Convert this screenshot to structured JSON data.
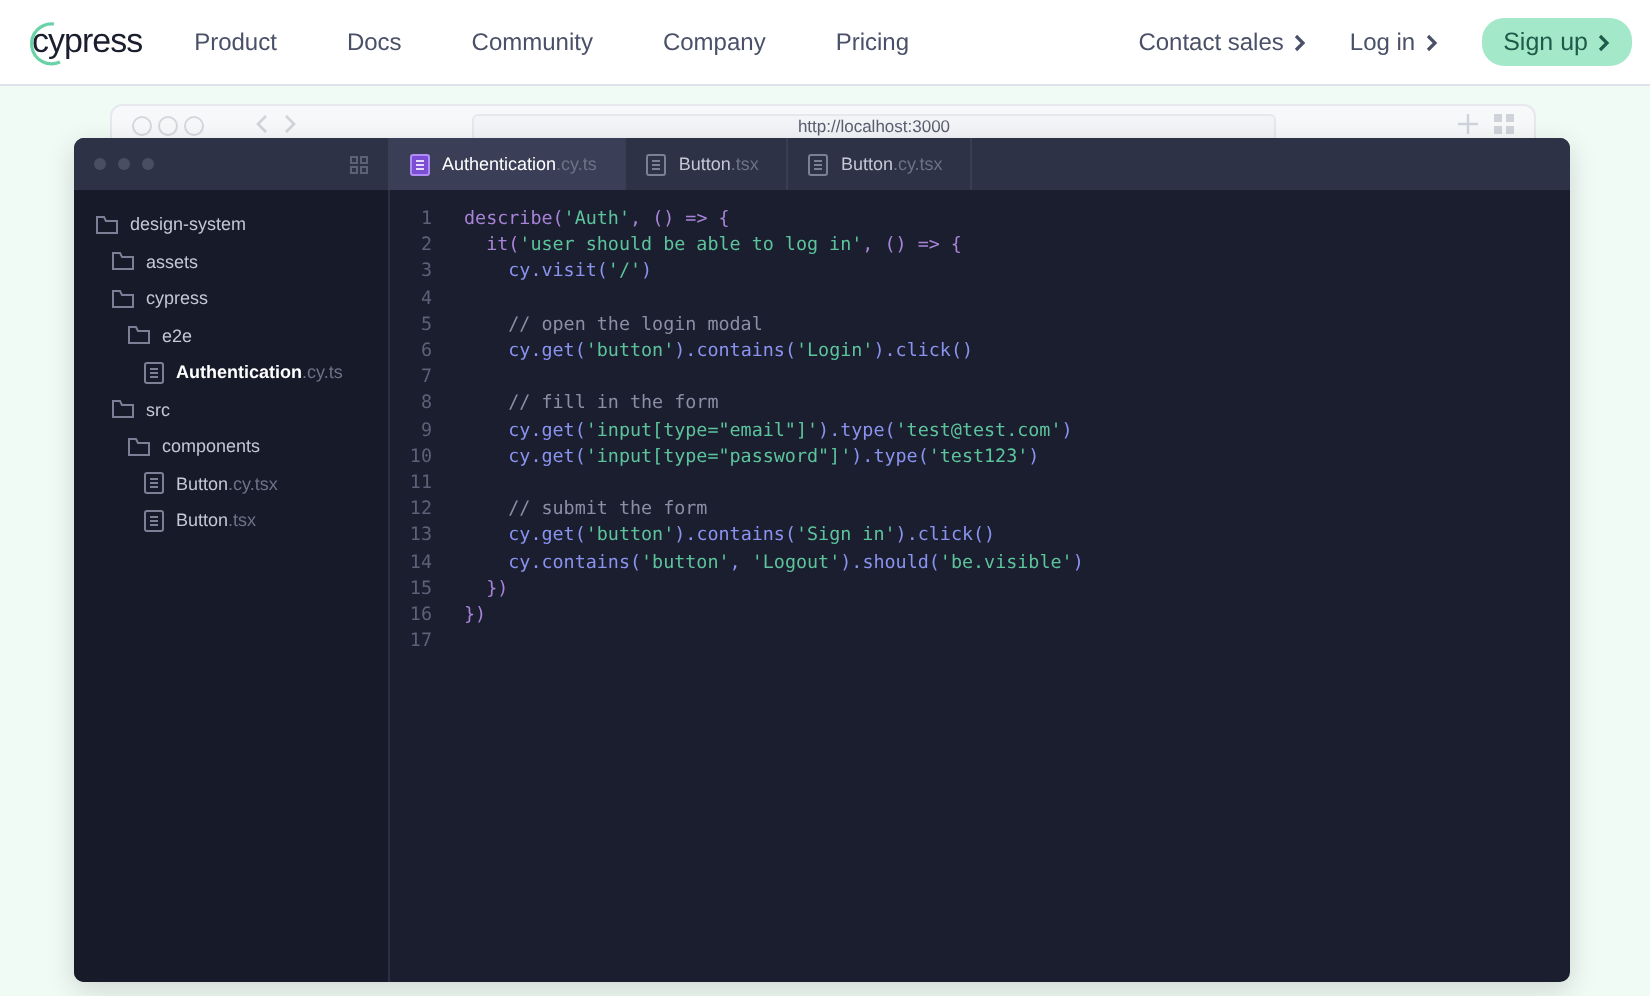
{
  "nav": {
    "logo": "cypress",
    "links": [
      "Product",
      "Docs",
      "Community",
      "Company",
      "Pricing"
    ],
    "right_links": [
      "Contact sales",
      "Log in"
    ],
    "cta": "Sign up"
  },
  "browser": {
    "url": "http://localhost:3000"
  },
  "editor": {
    "tabs": [
      {
        "name": "Authentication",
        "ext": ".cy.ts",
        "selected": true
      },
      {
        "name": "Button",
        "ext": ".tsx",
        "selected": false
      },
      {
        "name": "Button",
        "ext": ".cy.tsx",
        "selected": false
      }
    ],
    "tree": [
      {
        "kind": "folder",
        "name": "design-system",
        "selected": false,
        "children": [
          {
            "kind": "folder",
            "name": "assets",
            "selected": false
          },
          {
            "kind": "folder",
            "name": "cypress",
            "selected": false,
            "children": [
              {
                "kind": "folder",
                "name": "e2e",
                "selected": false,
                "children": [
                  {
                    "kind": "file",
                    "name": "Authentication",
                    "ext": ".cy.ts",
                    "selected": true
                  }
                ]
              }
            ]
          },
          {
            "kind": "folder",
            "name": "src",
            "selected": false,
            "children": [
              {
                "kind": "folder",
                "name": "components",
                "selected": false,
                "children": [
                  {
                    "kind": "file",
                    "name": "Button",
                    "ext": ".cy.tsx",
                    "selected": false
                  },
                  {
                    "kind": "file",
                    "name": "Button",
                    "ext": ".tsx",
                    "selected": false
                  }
                ]
              }
            ]
          }
        ]
      }
    ],
    "code": [
      {
        "number": "1",
        "tokens": [
          {
            "kind": "keyword",
            "text": "describe("
          },
          {
            "kind": "string",
            "text": "'Auth'"
          },
          {
            "kind": "keyword",
            "text": ", () => {"
          }
        ]
      },
      {
        "number": "2",
        "tokens": [
          {
            "kind": "keyword",
            "text": "  it("
          },
          {
            "kind": "string",
            "text": "'user should be able to log in'"
          },
          {
            "kind": "keyword",
            "text": ", () => {"
          }
        ]
      },
      {
        "number": "3",
        "tokens": [
          {
            "kind": "call",
            "text": "    cy.visit("
          },
          {
            "kind": "string",
            "text": "'/'"
          },
          {
            "kind": "call",
            "text": ")"
          }
        ]
      },
      {
        "number": "4"
      },
      {
        "number": "5",
        "tokens": [
          {
            "kind": "comment",
            "text": "    // open the login modal"
          }
        ]
      },
      {
        "number": "6",
        "tokens": [
          {
            "kind": "call",
            "text": "    cy.get("
          },
          {
            "kind": "string",
            "text": "'button'"
          },
          {
            "kind": "call",
            "text": ").contains("
          },
          {
            "kind": "string",
            "text": "'Login'"
          },
          {
            "kind": "call",
            "text": ").click()"
          }
        ]
      },
      {
        "number": "7"
      },
      {
        "number": "8",
        "tokens": [
          {
            "kind": "comment",
            "text": "    // fill in the form"
          }
        ]
      },
      {
        "number": "9",
        "tokens": [
          {
            "kind": "call",
            "text": "    cy.get("
          },
          {
            "kind": "string",
            "text": "'input[type=\"email\"]'"
          },
          {
            "kind": "call",
            "text": ").type("
          },
          {
            "kind": "string",
            "text": "'test@test.com'"
          },
          {
            "kind": "call",
            "text": ")"
          }
        ]
      },
      {
        "number": "10",
        "tokens": [
          {
            "kind": "call",
            "text": "    cy.get("
          },
          {
            "kind": "string",
            "text": "'input[type=\"password\"]'"
          },
          {
            "kind": "call",
            "text": ").type("
          },
          {
            "kind": "string",
            "text": "'test123'"
          },
          {
            "kind": "call",
            "text": ")"
          }
        ]
      },
      {
        "number": "11"
      },
      {
        "number": "12",
        "tokens": [
          {
            "kind": "comment",
            "text": "    // submit the form"
          }
        ]
      },
      {
        "number": "13",
        "tokens": [
          {
            "kind": "call",
            "text": "    cy.get("
          },
          {
            "kind": "string",
            "text": "'button'"
          },
          {
            "kind": "call",
            "text": ").contains("
          },
          {
            "kind": "string",
            "text": "'Sign in'"
          },
          {
            "kind": "call",
            "text": ").click()"
          }
        ]
      },
      {
        "number": "14",
        "tokens": [
          {
            "kind": "call",
            "text": "    cy.contains("
          },
          {
            "kind": "string",
            "text": "'button'"
          },
          {
            "kind": "call",
            "text": ", "
          },
          {
            "kind": "string",
            "text": "'Logout'"
          },
          {
            "kind": "call",
            "text": ").should("
          },
          {
            "kind": "string",
            "text": "'be.visible'"
          },
          {
            "kind": "call",
            "text": ")"
          }
        ]
      },
      {
        "number": "15",
        "tokens": [
          {
            "kind": "keyword",
            "text": "  })"
          }
        ]
      },
      {
        "number": "16",
        "tokens": [
          {
            "kind": "keyword",
            "text": "})"
          }
        ]
      },
      {
        "number": "17"
      }
    ]
  }
}
